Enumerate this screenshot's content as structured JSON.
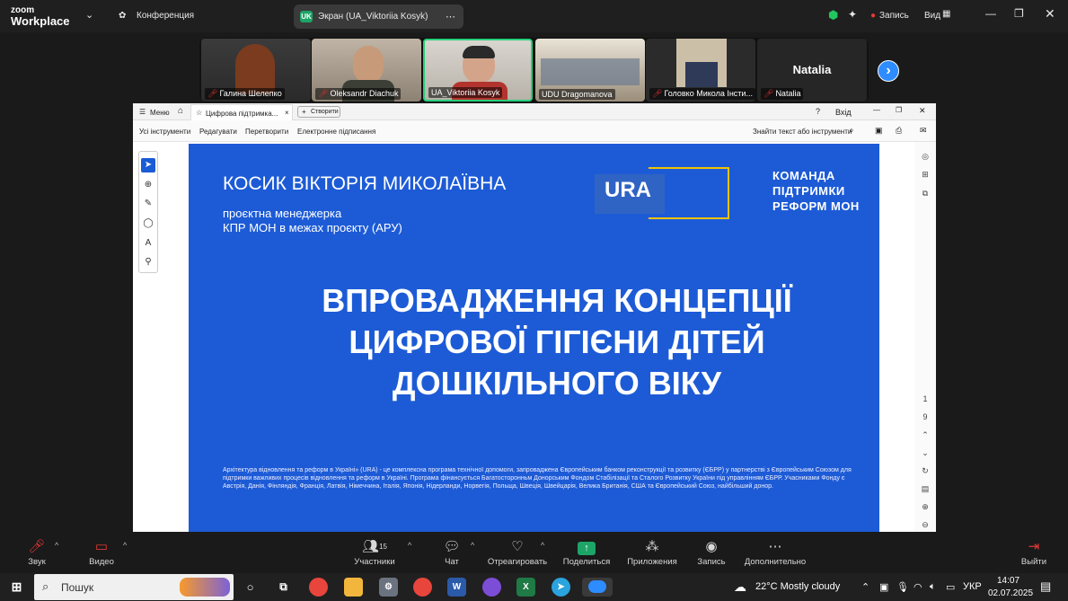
{
  "zoom": {
    "logo_line1": "zoom",
    "logo_line2": "Workplace",
    "conference_label": "Конференция",
    "screen_tab_badge": "UK",
    "screen_tab_label": "Экран (UA_Viktoriia Kosyk)",
    "record_label": "Запись",
    "view_label": "Вид"
  },
  "participants": [
    {
      "name": "Галина Шелепко",
      "muted": true
    },
    {
      "name": "Oleksandr Diachuk",
      "muted": true
    },
    {
      "name": "UA_Viktoriia Kosyk",
      "muted": false
    },
    {
      "name": "UDU Dragomanova",
      "muted": false
    },
    {
      "name": "Головко Микола Інсти...",
      "muted": true
    },
    {
      "name": "Natalia",
      "muted": true,
      "big_label": "Natalia"
    }
  ],
  "app": {
    "menu_label": "Меню",
    "tab_title": "Цифрова підтримка...",
    "create_label": "Створити",
    "signin_label": "Вхід",
    "tools": [
      "Усі інструменти",
      "Редагувати",
      "Перетворити",
      "Електронне підписання"
    ],
    "find_label": "Знайти текст або інструменти",
    "page_current": "1",
    "page_total": "9"
  },
  "slide": {
    "name": "КОСИК ВІКТОРІЯ МИКОЛАЇВНА",
    "role_line1": "проєктна менеджерка",
    "role_line2": "КПР МОН в межах проєкту (АРУ)",
    "ura_logo": "URA",
    "team_line1": "КОМАНДА",
    "team_line2": "ПІДТРИМКИ",
    "team_line3": "РЕФОРМ МОН",
    "title_line1": "ВПРОВАДЖЕННЯ КОНЦЕПЦІЇ",
    "title_line2": "ЦИФРОВОЇ ГІГІЄНИ ДІТЕЙ",
    "title_line3": "ДОШКІЛЬНОГО ВІКУ",
    "footer": "Архітектура відновлення та реформ в Україні» (URA) - це комплексна програма технічної допомоги, запроваджена Європейським банком реконструкції та розвитку (ЄБРР) у партнерстві з Європейським Союзом для підтримки важливих процесів відновлення та реформ в Україні. Програма фінансується Багатосторонньм Донорським Фондом Стабілізації та Сталого Розвитку України під управлінням ЄБРР. Учасниками Фонду є Австрія, Данія, Фінляндія, Франція, Латвія, Німеччина, Італія, Японія, Нідерланди, Норвегія, Польща, Швеція, Швейцарія, Велика Британія, США та Європейський Союз, найбільший донор."
  },
  "toolbar": {
    "audio": "Звук",
    "video": "Видео",
    "participants": "Участники",
    "participants_count": "15",
    "chat": "Чат",
    "react": "Отреагировать",
    "share": "Поделиться",
    "apps": "Приложения",
    "record": "Запись",
    "more": "Дополнительно",
    "leave": "Выйти"
  },
  "taskbar": {
    "search_placeholder": "Пошук",
    "weather": "22°C  Mostly cloudy",
    "lang": "УКР",
    "time": "14:07",
    "date": "02.07.2025"
  },
  "colors": {
    "slide_bg": "#1d5bd6",
    "accent_yellow": "#f2c200",
    "zoom_blue": "#2d8cff",
    "share_green": "#1da467"
  }
}
